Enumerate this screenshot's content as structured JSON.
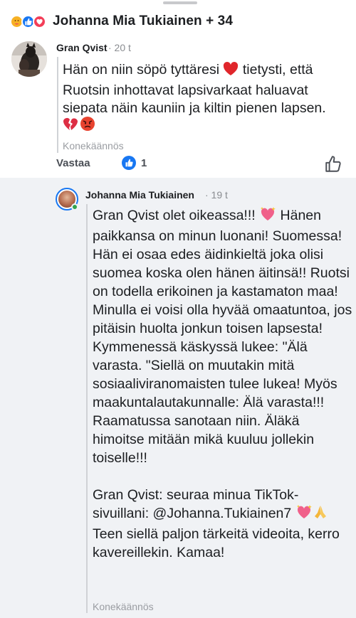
{
  "header": {
    "title": "Johanna Mia Tukiainen + 34",
    "reactions": [
      "care-reaction-icon",
      "like-reaction-icon",
      "love-reaction-icon"
    ]
  },
  "comment": {
    "author": "Gran Qvist",
    "time": "· 20 t",
    "text_before_heart": "Hän on niin söpö tyttäresi ",
    "text_after_heart": " tietysti, että Ruotsin inhottavat lapsivarkaat haluavat siepata näin kauniin ja kiltin pienen lapsen.",
    "translate_label": "Konekäännös",
    "reply_label": "Vastaa",
    "like_count": "1"
  },
  "reply": {
    "author": "Johanna Mia Tukiainen",
    "time": "· 19 t",
    "p1_a": "Gran Qvist olet oikeassa!!! ",
    "p1_b": " Hänen paikkansa on minun luonani! Suomessa! Hän ei osaa edes äidinkieltä joka olisi suomea koska olen hänen äitinsä!! Ruotsi on todella erikoinen ja kastamaton maa! Minulla ei voisi olla hyvää omaatuntoa, jos pitäisin huolta jonkun toisen lapsesta! Kymmenessä käskyssä lukee: \"Älä varasta. \"Siellä on muutakin mitä sosiaaliviranomaisten tulee lukea! Myös maakuntalautakunnalle: Älä varasta!!! Raamatussa sanotaan niin. Äläkä himoitse mitään mikä kuuluu jollekin toiselle!!!",
    "p2_a": "Gran Qvist: seuraa minua TikTok-sivuillani: @Johanna.Tukiainen7 ",
    "p2_b": " Teen siellä paljon tärkeitä videoita, kerro kavereillekin. Kamaa!",
    "translate_label": "Konekäännös"
  },
  "colors": {
    "accent": "#1877f2",
    "love": "#f33e58",
    "background_reply": "#f0f2f5",
    "meta_gray": "#8a8d91"
  }
}
